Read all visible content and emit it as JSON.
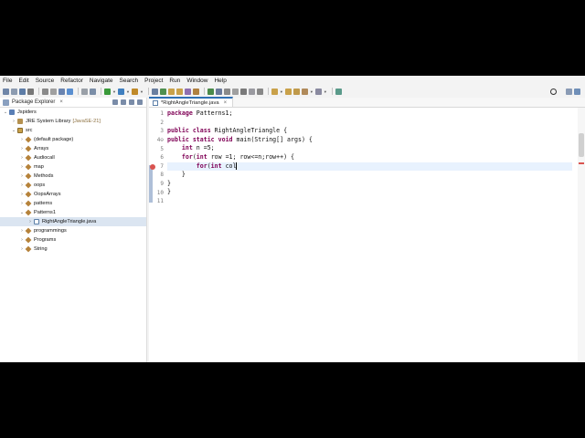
{
  "menu": [
    "File",
    "Edit",
    "Source",
    "Refactor",
    "Navigate",
    "Search",
    "Project",
    "Run",
    "Window",
    "Help"
  ],
  "explorer": {
    "tab_label": "Package Explorer",
    "tab_close": "×",
    "tree": [
      {
        "label": "Jspiders",
        "depth": 0,
        "twisty": "⌄",
        "icon": "project"
      },
      {
        "label": "JRE System Library",
        "deco": "[JavaSE-21]",
        "depth": 1,
        "twisty": "›",
        "icon": "lib"
      },
      {
        "label": "src",
        "depth": 1,
        "twisty": "⌄",
        "icon": "src"
      },
      {
        "label": "(default package)",
        "depth": 2,
        "twisty": "›",
        "icon": "pkg"
      },
      {
        "label": "Arrays",
        "depth": 2,
        "twisty": "›",
        "icon": "pkg"
      },
      {
        "label": "Audiocall",
        "depth": 2,
        "twisty": "›",
        "icon": "pkg"
      },
      {
        "label": "map",
        "depth": 2,
        "twisty": "›",
        "icon": "pkg"
      },
      {
        "label": "Methods",
        "depth": 2,
        "twisty": "›",
        "icon": "pkg"
      },
      {
        "label": "oops",
        "depth": 2,
        "twisty": "›",
        "icon": "pkg"
      },
      {
        "label": "OopsArrays",
        "depth": 2,
        "twisty": "›",
        "icon": "pkg"
      },
      {
        "label": "patterns",
        "depth": 2,
        "twisty": "›",
        "icon": "pkg"
      },
      {
        "label": "Patterns1",
        "depth": 2,
        "twisty": "⌄",
        "icon": "pkg"
      },
      {
        "label": "RightAngleTriangle.java",
        "depth": 3,
        "twisty": "›",
        "icon": "java",
        "selected": true
      },
      {
        "label": "programmings",
        "depth": 2,
        "twisty": "›",
        "icon": "pkg"
      },
      {
        "label": "Programs",
        "depth": 2,
        "twisty": "›",
        "icon": "pkg"
      },
      {
        "label": "String",
        "depth": 2,
        "twisty": "›",
        "icon": "pkg"
      }
    ]
  },
  "editor": {
    "tab_label": "*RightAngleTriangle.java",
    "tab_close": "×",
    "lines": [
      {
        "n": "1",
        "tokens": [
          {
            "t": "package",
            "k": true
          },
          {
            "t": " Patterns1;"
          }
        ]
      },
      {
        "n": "2",
        "tokens": []
      },
      {
        "n": "3",
        "tokens": [
          {
            "t": "public",
            "k": true
          },
          {
            "t": " "
          },
          {
            "t": "class",
            "k": true
          },
          {
            "t": " RightAngleTriangle {"
          }
        ]
      },
      {
        "n": "4⊖",
        "tokens": [
          {
            "t": "public",
            "k": true
          },
          {
            "t": " "
          },
          {
            "t": "static",
            "k": true
          },
          {
            "t": " "
          },
          {
            "t": "void",
            "k": true
          },
          {
            "t": " main(String[] args) {"
          }
        ]
      },
      {
        "n": "5",
        "tokens": [
          {
            "t": "    "
          },
          {
            "t": "int",
            "k": true
          },
          {
            "t": " n =5;"
          }
        ]
      },
      {
        "n": "6",
        "tokens": [
          {
            "t": "    "
          },
          {
            "t": "for",
            "k": true
          },
          {
            "t": "("
          },
          {
            "t": "int",
            "k": true
          },
          {
            "t": " row =1; row<=n;row++) {"
          }
        ]
      },
      {
        "n": "7",
        "tokens": [
          {
            "t": "        "
          },
          {
            "t": "for",
            "k": true
          },
          {
            "t": "("
          },
          {
            "t": "int",
            "k": true
          },
          {
            "t": " col"
          }
        ],
        "current": true,
        "error": true
      },
      {
        "n": "8",
        "tokens": [
          {
            "t": "    }"
          }
        ]
      },
      {
        "n": "9",
        "tokens": [
          {
            "t": "}"
          }
        ]
      },
      {
        "n": "10",
        "tokens": [
          {
            "t": "}"
          }
        ]
      },
      {
        "n": "11",
        "tokens": []
      }
    ]
  },
  "colors": {
    "keyword": "#7f0055",
    "current_line": "#e8f2fe",
    "error": "#d9534f",
    "selection": "#dbe5f1"
  }
}
